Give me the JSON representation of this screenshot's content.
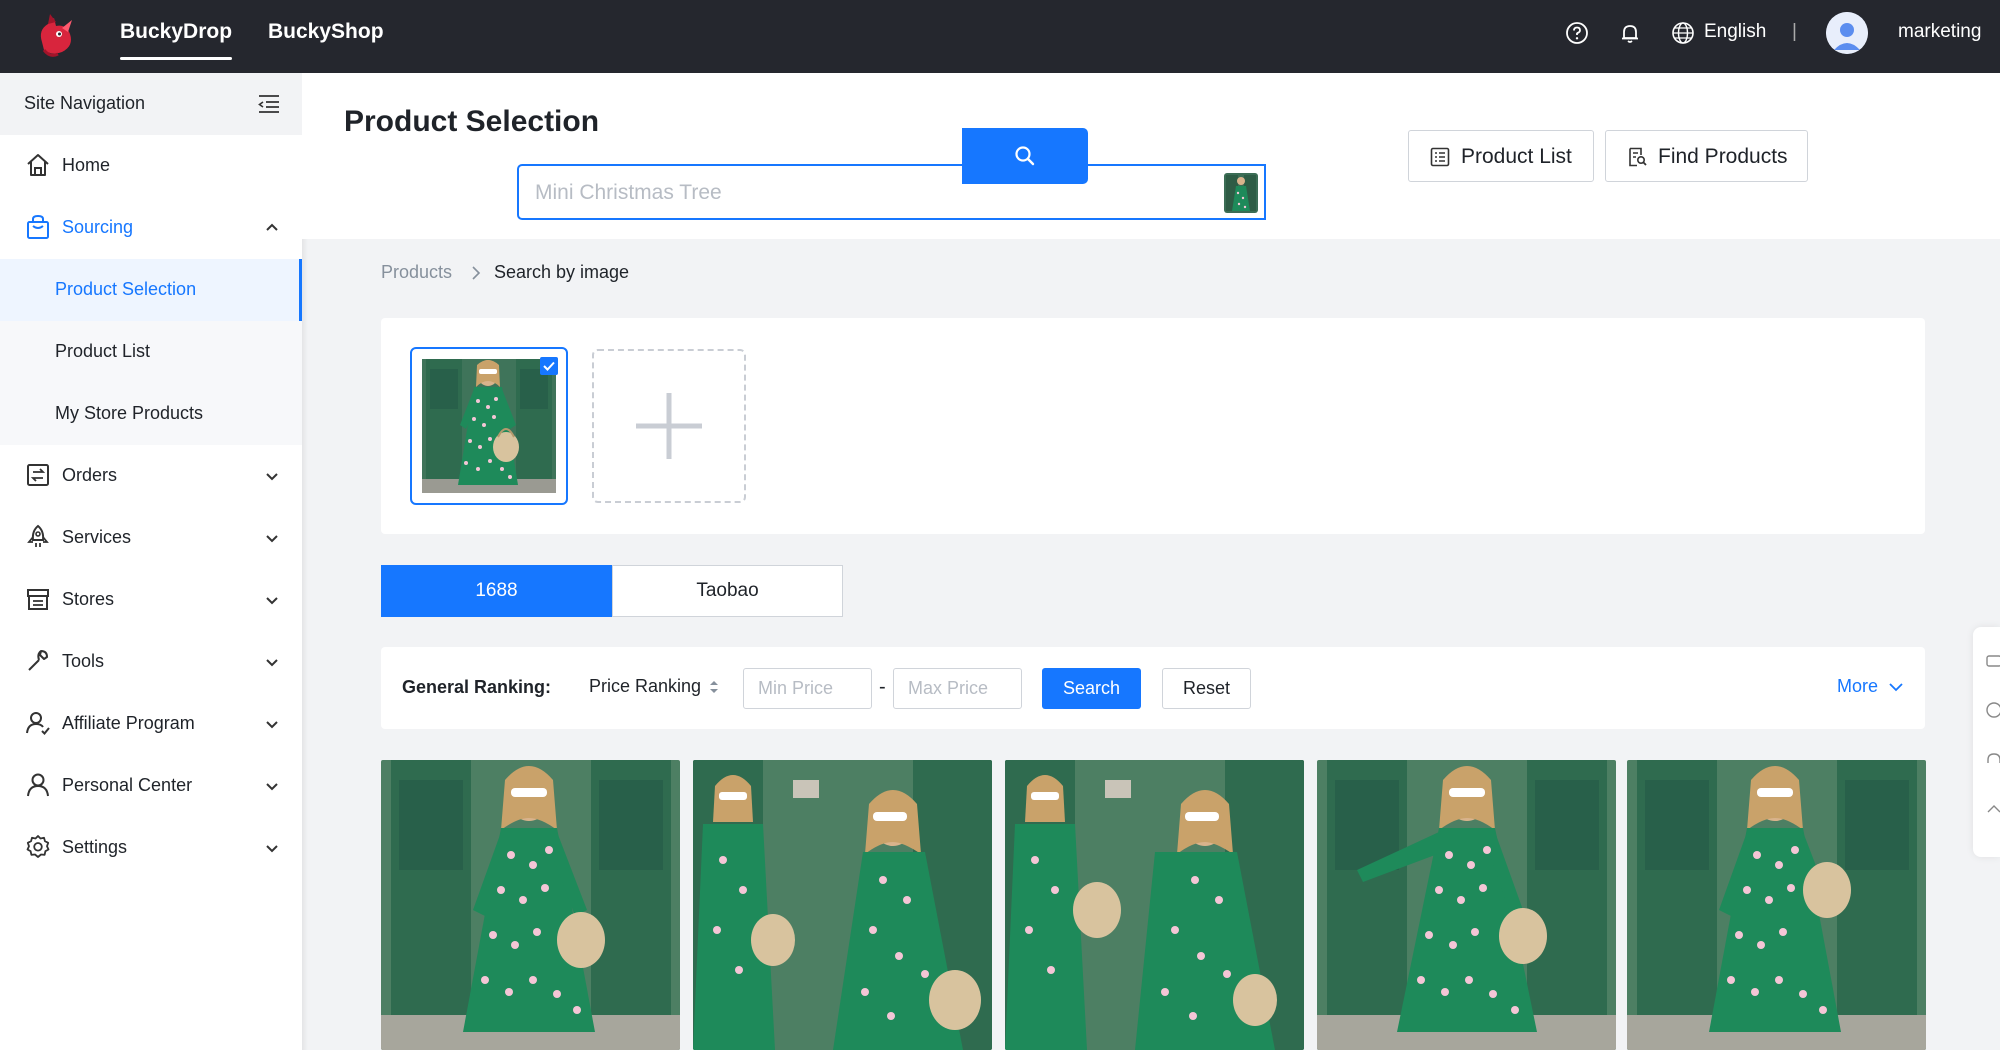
{
  "topbar": {
    "tabs": [
      "BuckyDrop",
      "BuckyShop"
    ],
    "language": "English",
    "divider": "|",
    "username": "marketing"
  },
  "sidebar": {
    "header": "Site Navigation",
    "items": [
      {
        "label": "Home",
        "icon": "home-icon"
      },
      {
        "label": "Sourcing",
        "icon": "shopping-bag-icon"
      },
      {
        "label": "Orders",
        "icon": "orders-icon"
      },
      {
        "label": "Services",
        "icon": "rocket-icon"
      },
      {
        "label": "Stores",
        "icon": "store-icon"
      },
      {
        "label": "Tools",
        "icon": "wrench-icon"
      },
      {
        "label": "Affiliate Program",
        "icon": "affiliate-icon"
      },
      {
        "label": "Personal Center",
        "icon": "user-icon"
      },
      {
        "label": "Settings",
        "icon": "gear-icon"
      }
    ],
    "sourcing_sub": [
      "Product Selection",
      "Product List",
      "My Store Products"
    ]
  },
  "header": {
    "title": "Product Selection",
    "search_placeholder": "Mini Christmas Tree",
    "product_list_btn": "Product List",
    "find_products_btn": "Find Products"
  },
  "breadcrumb": {
    "root": "Products",
    "separator": ">",
    "current": "Search by image"
  },
  "source_tabs": [
    "1688",
    "Taobao"
  ],
  "filters": {
    "general_ranking": "General Ranking:",
    "price_ranking": "Price Ranking",
    "min_price_placeholder": "Min Price",
    "dash": "-",
    "max_price_placeholder": "Max Price",
    "search": "Search",
    "reset": "Reset",
    "more": "More"
  },
  "colors": {
    "accent": "#1677ff",
    "topbar": "#25272e",
    "dress_green": "#1e8a5a",
    "door_green": "#2f6b4f"
  }
}
